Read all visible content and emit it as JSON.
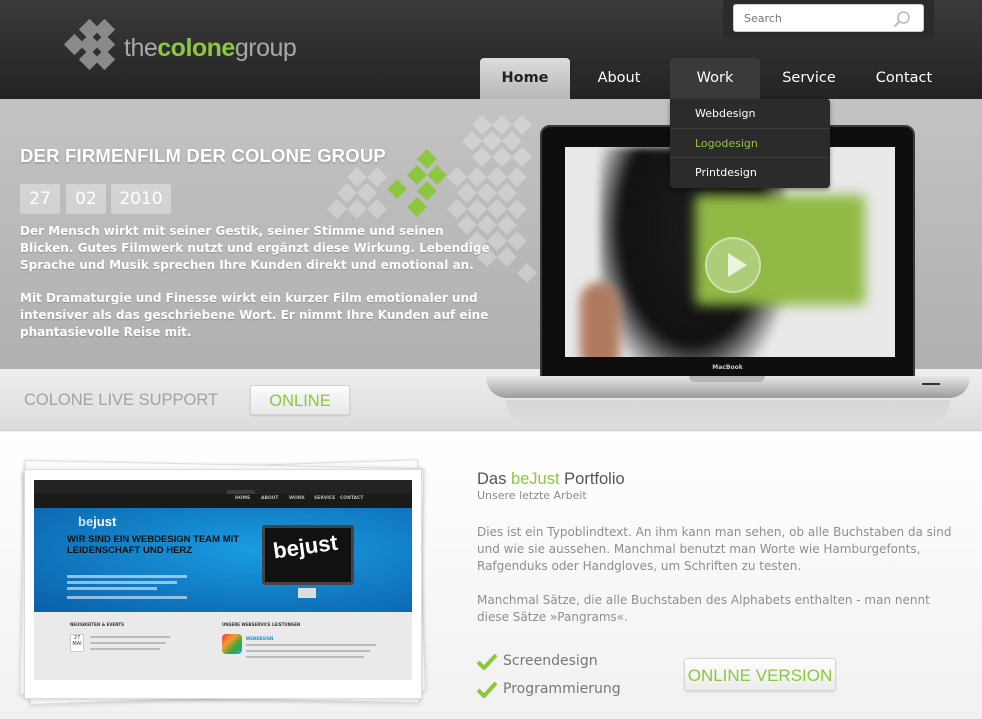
{
  "header": {
    "logo": {
      "part1": "the",
      "part2": "colone",
      "part3": "group"
    },
    "search": {
      "placeholder": "Search"
    },
    "nav": [
      {
        "label": "Home"
      },
      {
        "label": "About"
      },
      {
        "label": "Work"
      },
      {
        "label": "Service"
      },
      {
        "label": "Contact"
      }
    ],
    "dropdown": [
      {
        "label": "Webdesign"
      },
      {
        "label": "Logodesign"
      },
      {
        "label": "Printdesign"
      }
    ]
  },
  "hero": {
    "title": "DER FIRMENFILM DER COLONE GROUP",
    "date": {
      "day": "27",
      "month": "02",
      "year": "2010"
    },
    "paragraph1": "Der Mensch wirkt mit seiner Gestik, seiner Stimme und seinen Blicken. Gutes Filmwerk nutzt und ergänzt diese Wirkung. Lebendige Sprache und Musik sprechen Ihre Kunden direkt und emotional an.",
    "paragraph2": "Mit Dramaturgie und Finesse wirkt ein kurzer Film emotionaler und intensiver als das geschriebene Wort. Er nimmt Ihre Kunden auf eine phantasievolle Reise mit.",
    "laptop_brand": "MacBook"
  },
  "support": {
    "label": "COLONE LIVE SUPPORT",
    "status": "ONLINE"
  },
  "portfolio": {
    "title_prefix": "Das ",
    "title_highlight": "beJust",
    "title_suffix": " Portfolio",
    "subtitle": "Unsere letzte Arbeit",
    "paragraph1": "Dies ist ein Typoblindtext. An ihm kann man sehen, ob alle Buchstaben da sind und wie sie aussehen. Manchmal benutzt man Worte wie Hamburgefonts, Rafgenduks oder Handgloves, um Schriften zu testen.",
    "paragraph2": "Manchmal Sätze, die alle Buchstaben des Alphabets enthalten - man nennt diese Sätze »Pangrams«.",
    "features": [
      {
        "label": "Screendesign"
      },
      {
        "label": "Programmierung"
      }
    ],
    "online_button": "ONLINE VERSION",
    "preview": {
      "logo_be": "be",
      "logo_just": "just",
      "headline": "WIR SIND EIN WEBDESIGN TEAM MIT LEIDENSCHAFT UND HERZ",
      "monitor_text": "bejust",
      "nav": [
        "HOME",
        "ABOUT",
        "WORK",
        "SERVICE",
        "CONTACT"
      ],
      "news_heading": "NEUIGKEITEN & EVENTS",
      "services_heading": "UNSERE WEBSERVICE LEISTUNGEN",
      "news_date_day": "27",
      "news_date_month": "MAI",
      "service_item": "WEBDESIGN"
    }
  },
  "colors": {
    "accent": "#8dc63f",
    "header_bg": "#2b2b2b",
    "hero_bg": "#bcbcbc"
  }
}
